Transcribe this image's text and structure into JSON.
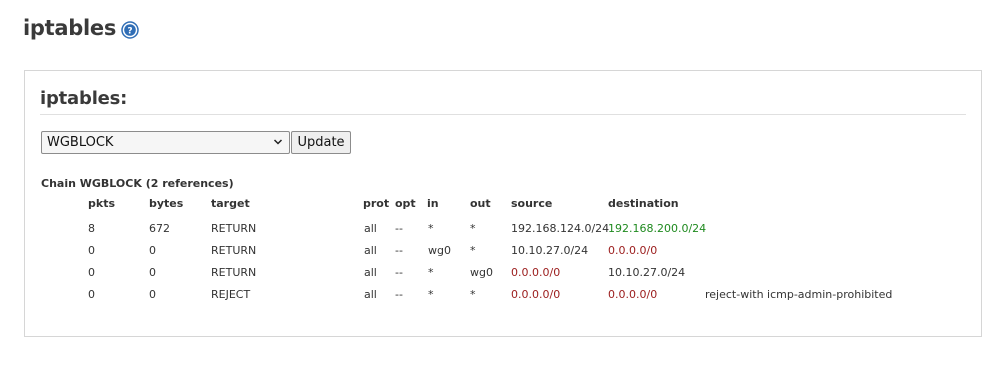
{
  "page": {
    "title": "iptables"
  },
  "section": {
    "title": "iptables:"
  },
  "controls": {
    "selected_chain": "WGBLOCK",
    "update_label": "Update"
  },
  "chain": {
    "header": "Chain WGBLOCK (2 references)",
    "columns": {
      "pkts": "pkts",
      "bytes": "bytes",
      "target": "target",
      "prot": "prot",
      "opt": "opt",
      "in": "in",
      "out": "out",
      "source": "source",
      "destination": "destination"
    },
    "rows": [
      {
        "pkts": "8",
        "bytes": "672",
        "target": "RETURN",
        "prot": "all",
        "opt": "--",
        "in": "*",
        "out": "*",
        "source": "192.168.124.0/24",
        "destination": "192.168.200.0/24",
        "extra": ""
      },
      {
        "pkts": "0",
        "bytes": "0",
        "target": "RETURN",
        "prot": "all",
        "opt": "--",
        "in": "wg0",
        "out": "*",
        "source": "10.10.27.0/24",
        "destination": "0.0.0.0/0",
        "extra": ""
      },
      {
        "pkts": "0",
        "bytes": "0",
        "target": "RETURN",
        "prot": "all",
        "opt": "--",
        "in": "*",
        "out": "wg0",
        "source": "0.0.0.0/0",
        "destination": "10.10.27.0/24",
        "extra": ""
      },
      {
        "pkts": "0",
        "bytes": "0",
        "target": "REJECT",
        "prot": "all",
        "opt": "--",
        "in": "*",
        "out": "*",
        "source": "0.0.0.0/0",
        "destination": "0.0.0.0/0",
        "extra": "reject-with icmp-admin-prohibited"
      }
    ]
  },
  "colors": {
    "any_address": "#9b1c1c",
    "match_address": "#1f8a1f",
    "help_icon": "#2f6db5"
  }
}
